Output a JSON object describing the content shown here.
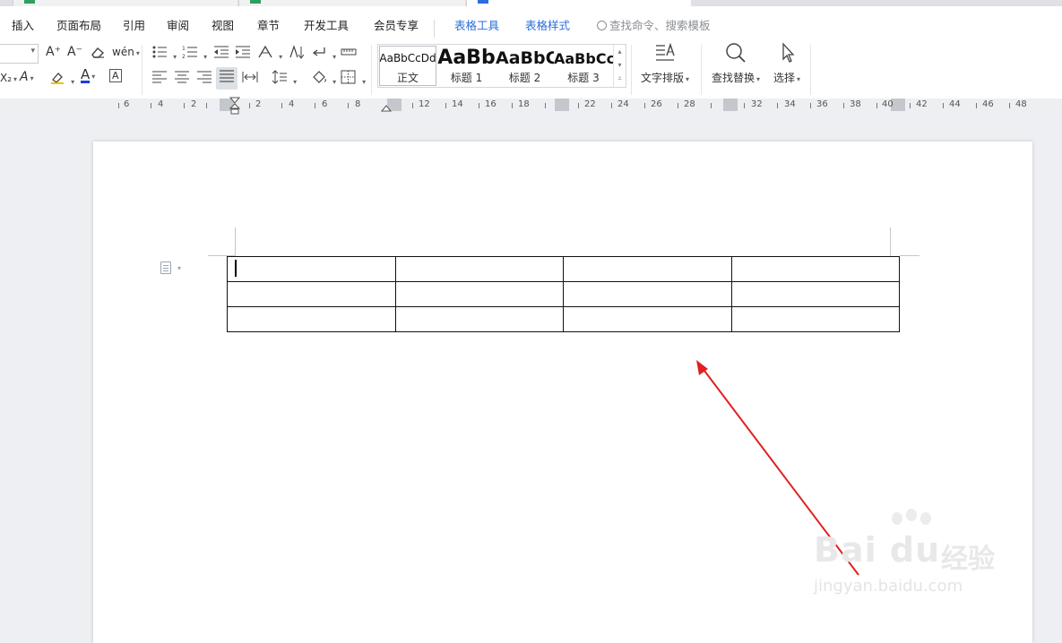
{
  "window": {
    "tabs_count": 3
  },
  "menubar": {
    "items": [
      "插入",
      "页面布局",
      "引用",
      "审阅",
      "视图",
      "章节",
      "开发工具",
      "会员专享"
    ],
    "context_tabs": [
      "表格工具",
      "表格样式"
    ],
    "search_placeholder": "查找命令、搜索模板",
    "accent_color": "#2b6fd6"
  },
  "ribbon": {
    "font_size_a_up": "A⁺",
    "font_size_a_down": "A⁻",
    "phonetic_label": "wén",
    "subscript_label": "X₂",
    "text_effect_label": "A",
    "font_color_label": "A",
    "char_border_label": "A",
    "styles": [
      {
        "preview": "AaBbCcDd",
        "name": "正文"
      },
      {
        "preview": "AaBb",
        "name": "标题 1"
      },
      {
        "preview": "AaBbC",
        "name": "标题 2"
      },
      {
        "preview": "AaBbCc",
        "name": "标题 3"
      }
    ],
    "text_layout_label": "文字排版",
    "find_replace_label": "查找替换",
    "select_label": "选择",
    "font_color": "#1a3fd1",
    "highlight_color": "#f2c200"
  },
  "ruler": {
    "numbers": [
      "6",
      "4",
      "2",
      "2",
      "4",
      "6",
      "8",
      "12",
      "14",
      "16",
      "18",
      "22",
      "24",
      "26",
      "28",
      "32",
      "34",
      "36",
      "38",
      "40",
      "42",
      "44",
      "46",
      "48"
    ]
  },
  "document": {
    "table": {
      "rows": 3,
      "cols": 4,
      "cells": [
        [
          "",
          "",
          "",
          ""
        ],
        [
          "",
          "",
          "",
          ""
        ],
        [
          "",
          "",
          "",
          ""
        ]
      ]
    },
    "annotation_arrow_color": "#e02020"
  },
  "watermark": {
    "brand": "Bai du",
    "cn": "经验",
    "url": "jingyan.baidu.com"
  }
}
